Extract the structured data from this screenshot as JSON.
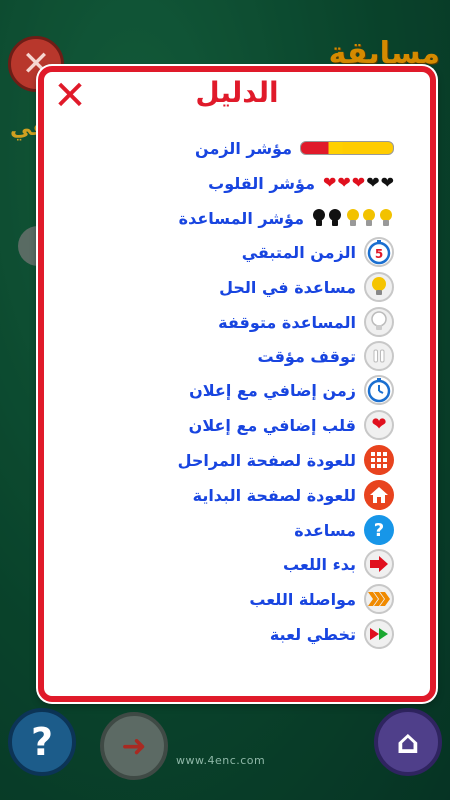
{
  "background": {
    "title_fragment": "مسابقة",
    "subtitle_fragment": "عي",
    "url": "www.4enc.com"
  },
  "modal": {
    "title": "الدليل",
    "rows": [
      {
        "label": "مؤشر الزمن",
        "icon": "time-bar-icon"
      },
      {
        "label": "مؤشر القلوب",
        "icon": "hearts-icon"
      },
      {
        "label": "مؤشر المساعدة",
        "icon": "bulbs-icon"
      },
      {
        "label": "الزمن المتبقي",
        "icon": "stopwatch-icon",
        "icon_text": "5"
      },
      {
        "label": "مساعدة في الحل",
        "icon": "lightbulb-icon"
      },
      {
        "label": "المساعدة متوقفة",
        "icon": "lightbulb-disabled-icon"
      },
      {
        "label": "توقف مؤقت",
        "icon": "pause-icon"
      },
      {
        "label": "زمن إضافي مع إعلان",
        "icon": "stopwatch-plus-icon"
      },
      {
        "label": "قلب إضافي مع إعلان",
        "icon": "heart-icon"
      },
      {
        "label": "للعودة لصفحة المراحل",
        "icon": "grid-icon"
      },
      {
        "label": "للعودة لصفحة البداية",
        "icon": "home-icon"
      },
      {
        "label": "مساعدة",
        "icon": "help-icon",
        "icon_text": "?"
      },
      {
        "label": "بدء اللعب",
        "icon": "play-arrow-icon"
      },
      {
        "label": "مواصلة اللعب",
        "icon": "continue-chevrons-icon"
      },
      {
        "label": "تخطي لعبة",
        "icon": "skip-icon"
      }
    ]
  }
}
